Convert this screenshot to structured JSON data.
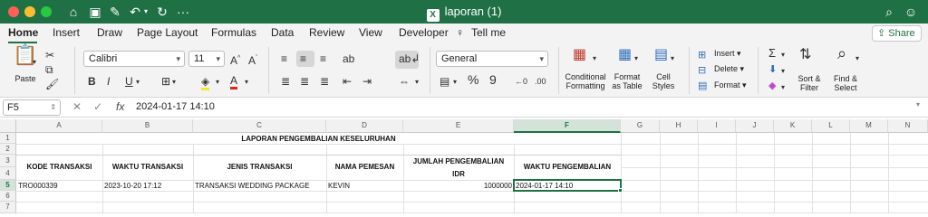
{
  "window": {
    "title": "laporan (1)"
  },
  "tabs": [
    "Home",
    "Insert",
    "Draw",
    "Page Layout",
    "Formulas",
    "Data",
    "Review",
    "View",
    "Developer",
    "Tell me"
  ],
  "share_label": "Share",
  "ribbon": {
    "paste_label": "Paste",
    "font_name": "Calibri",
    "font_size": "11",
    "number_format": "General",
    "conditional_formatting": [
      "Conditional",
      "Formatting"
    ],
    "format_as_table": [
      "Format",
      "as Table"
    ],
    "cell_styles": [
      "Cell",
      "Styles"
    ],
    "insert_label": "Insert",
    "delete_label": "Delete",
    "format_label": "Format",
    "sort_filter": [
      "Sort &",
      "Filter"
    ],
    "find_select": [
      "Find &",
      "Select"
    ]
  },
  "formula_bar": {
    "name_box": "F5",
    "formula": "2024-01-17 14:10"
  },
  "sheet": {
    "columns": [
      "A",
      "B",
      "C",
      "D",
      "E",
      "F",
      "G",
      "H",
      "I",
      "J",
      "K",
      "L",
      "M",
      "N"
    ],
    "rows": [
      "1",
      "2",
      "3",
      "4",
      "5",
      "6",
      "7"
    ],
    "title": "LAPORAN PENGEMBALIAN KESELURUHAN",
    "headers": {
      "kode": "KODE TRANSAKSI",
      "waktu": "WAKTU TRANSAKSI",
      "jenis": "JENIS TRANSAKSI",
      "nama": "NAMA PEMESAN",
      "jumlah_1": "JUMLAH PENGEMBALIAN",
      "jumlah_2": "IDR",
      "waktu_kembali": "WAKTU PENGEMBALIAN"
    },
    "row5": {
      "kode": "TRO000339",
      "waktu": "2023-10-20 17:12",
      "jenis": "TRANSAKSI WEDDING PACKAGE",
      "nama": "KEVIN",
      "jumlah": "1000000",
      "waktu_kembali": "2024-01-17 14:10"
    }
  },
  "colors": {
    "accent": "#1f7145",
    "active_fill": "#d3e3d8"
  }
}
